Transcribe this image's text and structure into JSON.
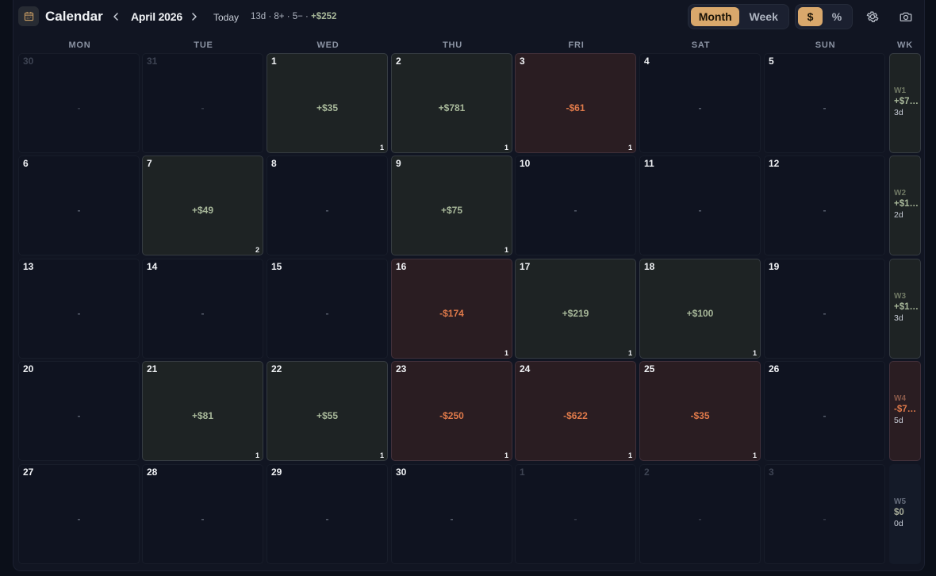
{
  "header": {
    "title": "Calendar",
    "month": "April 2026",
    "today_label": "Today",
    "stats_prefix": "13d · 8+ · 5− · ",
    "stats_pnl": "+$252",
    "view_modes": [
      "Month",
      "Week"
    ],
    "active_view": "Month",
    "units": [
      "$",
      "%"
    ],
    "active_unit": "$",
    "icons": [
      "calendar-icon",
      "chevron-left-icon",
      "chevron-right-icon",
      "gear-icon",
      "camera-icon"
    ]
  },
  "weekdays": [
    "MON",
    "TUE",
    "WED",
    "THU",
    "FRI",
    "SAT",
    "SUN",
    "WK"
  ],
  "weeks": [
    {
      "days": [
        {
          "day": "30",
          "pnl": "-",
          "count": "",
          "status": "other"
        },
        {
          "day": "31",
          "pnl": "-",
          "count": "",
          "status": "other"
        },
        {
          "day": "1",
          "pnl": "+$35",
          "count": "1",
          "status": "win"
        },
        {
          "day": "2",
          "pnl": "+$781",
          "count": "1",
          "status": "win"
        },
        {
          "day": "3",
          "pnl": "-$61",
          "count": "1",
          "status": "loss"
        },
        {
          "day": "4",
          "pnl": "-",
          "count": "",
          "status": "none"
        },
        {
          "day": "5",
          "pnl": "-",
          "count": "",
          "status": "none"
        }
      ],
      "summary": {
        "label": "W1",
        "pnl": "+$7…",
        "days": "3d",
        "status": "win"
      }
    },
    {
      "days": [
        {
          "day": "6",
          "pnl": "-",
          "count": "",
          "status": "none"
        },
        {
          "day": "7",
          "pnl": "+$49",
          "count": "2",
          "status": "win"
        },
        {
          "day": "8",
          "pnl": "-",
          "count": "",
          "status": "none"
        },
        {
          "day": "9",
          "pnl": "+$75",
          "count": "1",
          "status": "win"
        },
        {
          "day": "10",
          "pnl": "-",
          "count": "",
          "status": "none"
        },
        {
          "day": "11",
          "pnl": "-",
          "count": "",
          "status": "none"
        },
        {
          "day": "12",
          "pnl": "-",
          "count": "",
          "status": "none"
        }
      ],
      "summary": {
        "label": "W2",
        "pnl": "+$1…",
        "days": "2d",
        "status": "win"
      }
    },
    {
      "days": [
        {
          "day": "13",
          "pnl": "-",
          "count": "",
          "status": "none"
        },
        {
          "day": "14",
          "pnl": "-",
          "count": "",
          "status": "none"
        },
        {
          "day": "15",
          "pnl": "-",
          "count": "",
          "status": "none"
        },
        {
          "day": "16",
          "pnl": "-$174",
          "count": "1",
          "status": "loss"
        },
        {
          "day": "17",
          "pnl": "+$219",
          "count": "1",
          "status": "win"
        },
        {
          "day": "18",
          "pnl": "+$100",
          "count": "1",
          "status": "win"
        },
        {
          "day": "19",
          "pnl": "-",
          "count": "",
          "status": "none"
        }
      ],
      "summary": {
        "label": "W3",
        "pnl": "+$1…",
        "days": "3d",
        "status": "win"
      }
    },
    {
      "days": [
        {
          "day": "20",
          "pnl": "-",
          "count": "",
          "status": "none"
        },
        {
          "day": "21",
          "pnl": "+$81",
          "count": "1",
          "status": "win"
        },
        {
          "day": "22",
          "pnl": "+$55",
          "count": "1",
          "status": "win"
        },
        {
          "day": "23",
          "pnl": "-$250",
          "count": "1",
          "status": "loss"
        },
        {
          "day": "24",
          "pnl": "-$622",
          "count": "1",
          "status": "loss"
        },
        {
          "day": "25",
          "pnl": "-$35",
          "count": "1",
          "status": "loss"
        },
        {
          "day": "26",
          "pnl": "-",
          "count": "",
          "status": "none"
        }
      ],
      "summary": {
        "label": "W4",
        "pnl": "-$7…",
        "days": "5d",
        "status": "loss"
      }
    },
    {
      "days": [
        {
          "day": "27",
          "pnl": "-",
          "count": "",
          "status": "none"
        },
        {
          "day": "28",
          "pnl": "-",
          "count": "",
          "status": "none"
        },
        {
          "day": "29",
          "pnl": "-",
          "count": "",
          "status": "none"
        },
        {
          "day": "30",
          "pnl": "-",
          "count": "",
          "status": "none"
        },
        {
          "day": "1",
          "pnl": "-",
          "count": "",
          "status": "other"
        },
        {
          "day": "2",
          "pnl": "-",
          "count": "",
          "status": "other"
        },
        {
          "day": "3",
          "pnl": "-",
          "count": "",
          "status": "other"
        }
      ],
      "summary": {
        "label": "W5",
        "pnl": "$0",
        "days": "0d",
        "status": "empty"
      }
    }
  ],
  "colors": {
    "accent": "#d9a86c",
    "win_text": "#a8b89a",
    "loss_text": "#e07a4a",
    "win_bg": "#1e2324",
    "loss_bg": "#2a1d22",
    "background": "#111522"
  }
}
